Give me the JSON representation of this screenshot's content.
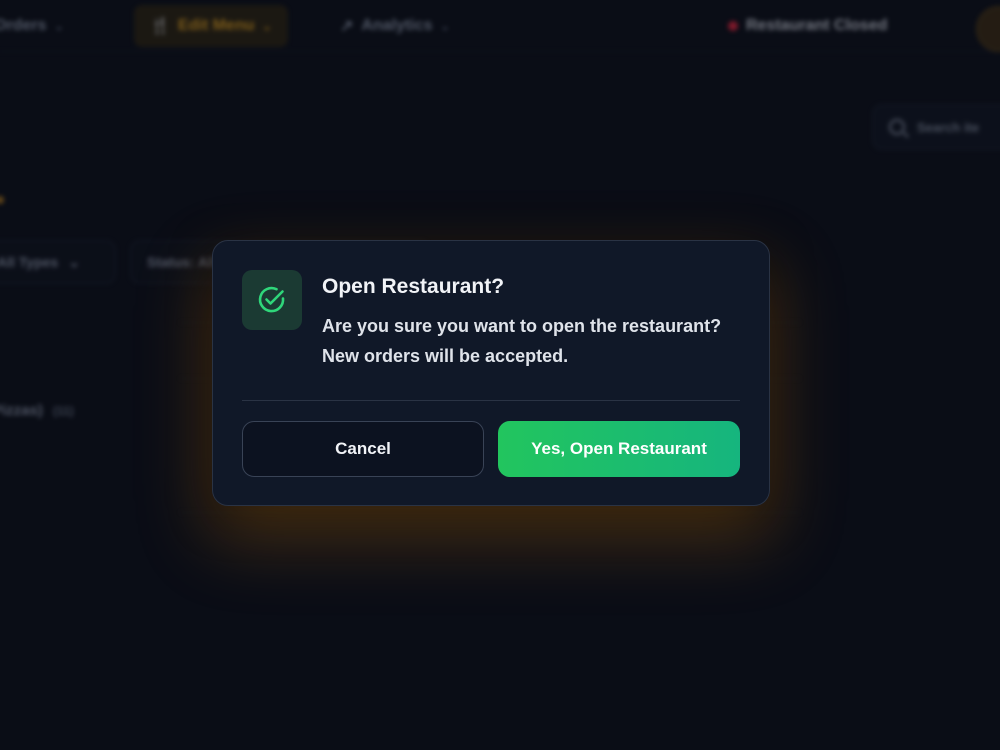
{
  "nav": {
    "orders_label": "Orders",
    "edit_menu_label": "Edit Menu",
    "analytics_label": "Analytics",
    "status_label": "Restaurant Closed",
    "status_color": "#d9233b",
    "accent_color": "#d89a1c"
  },
  "search": {
    "placeholder": "Search ite"
  },
  "filters": {
    "type_label": "All Types",
    "status_label": "Status: All"
  },
  "categories": [
    {
      "name": "Pizzas)",
      "count": "(11)"
    }
  ],
  "modal": {
    "icon": "check-circle-icon",
    "title": "Open Restaurant?",
    "message": "Are you sure you want to open the restaurant? New orders will be accepted.",
    "cancel_label": "Cancel",
    "confirm_label": "Yes, Open Restaurant",
    "confirm_color": "#22c55e"
  }
}
